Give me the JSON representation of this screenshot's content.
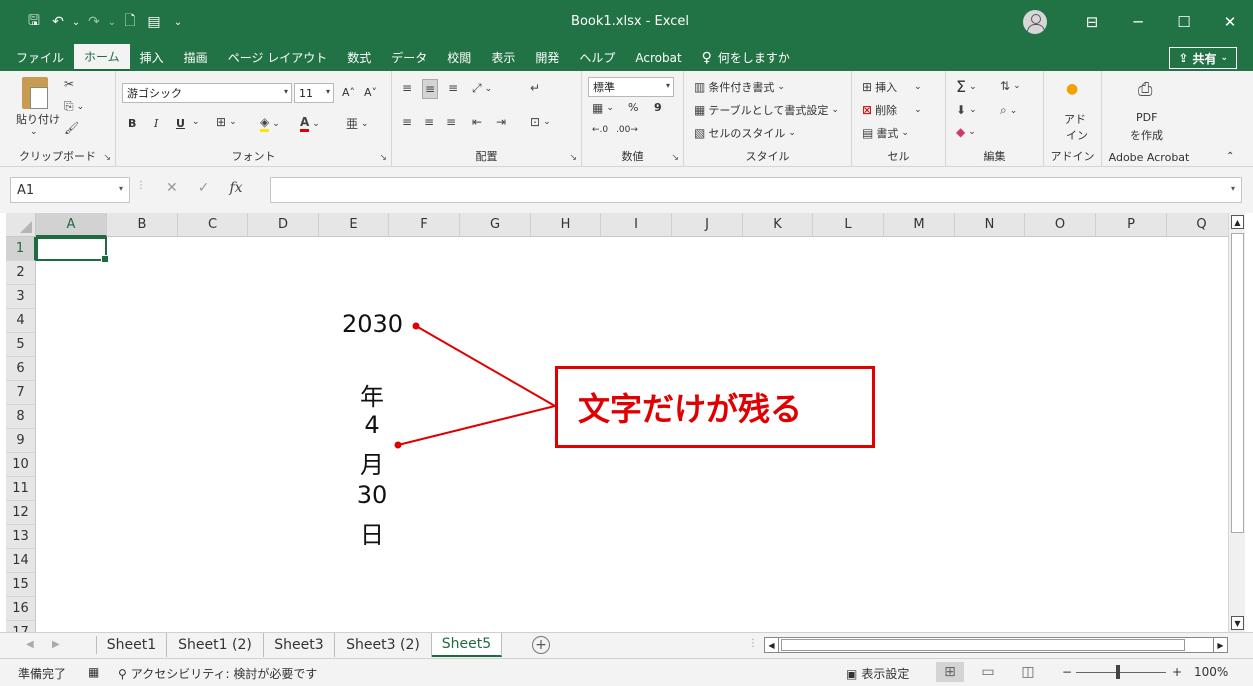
{
  "window": {
    "title": "Book1.xlsx  -  Excel",
    "share_label": "共有",
    "minimize": "─",
    "restore": "☐",
    "close": "✕",
    "ribbon_display": "⊟"
  },
  "qat": {
    "save": "🖫",
    "undo": "↶",
    "undo_caret": "⌄",
    "redo": "↷",
    "redo_caret": "⌄",
    "new": "🗋",
    "form": "▤",
    "customize": "⌄"
  },
  "tabs": [
    {
      "label": "ファイル"
    },
    {
      "label": "ホーム"
    },
    {
      "label": "挿入"
    },
    {
      "label": "描画"
    },
    {
      "label": "ページ レイアウト"
    },
    {
      "label": "数式"
    },
    {
      "label": "データ"
    },
    {
      "label": "校閲"
    },
    {
      "label": "表示"
    },
    {
      "label": "開発"
    },
    {
      "label": "ヘルプ"
    },
    {
      "label": "Acrobat"
    },
    {
      "label": "何をしますか"
    }
  ],
  "ribbon": {
    "clipboard": {
      "label": "クリップボード",
      "paste": "貼り付け"
    },
    "font": {
      "label": "フォント",
      "name": "游ゴシック",
      "size": "11",
      "bold": "B",
      "italic": "I",
      "underline": "U",
      "grow": "A˄",
      "shrink": "A˅"
    },
    "alignment": {
      "label": "配置"
    },
    "number": {
      "label": "数値",
      "format": "標準",
      "percent": "%",
      "comma": "9"
    },
    "styles": {
      "label": "スタイル",
      "conditional": "条件付き書式",
      "table": "テーブルとして書式設定",
      "cell_styles": "セルのスタイル"
    },
    "cells": {
      "label": "セル",
      "insert": "挿入",
      "delete": "削除",
      "format": "書式"
    },
    "editing": {
      "label": "編集",
      "sum": "Σ"
    },
    "addins": {
      "label": "アドイン",
      "button_line1": "アド",
      "button_line2": "イン"
    },
    "acrobat": {
      "label": "Adobe Acrobat",
      "button_line1": "PDF",
      "button_line2": "を作成"
    }
  },
  "formula_bar": {
    "name_box": "A1",
    "fx": "fx",
    "cancel": "✕",
    "enter": "✓",
    "formula": ""
  },
  "columns": [
    "A",
    "B",
    "C",
    "D",
    "E",
    "F",
    "G",
    "H",
    "I",
    "J",
    "K",
    "L",
    "M",
    "N",
    "O",
    "P",
    "Q"
  ],
  "rows": [
    "1",
    "2",
    "3",
    "4",
    "5",
    "6",
    "7",
    "8",
    "9",
    "10",
    "11",
    "12",
    "13",
    "14",
    "15",
    "16",
    "17"
  ],
  "cells": {
    "e4": "2030",
    "e7": "年",
    "e8": "4",
    "e9": "月",
    "e10": "30",
    "e11": "日"
  },
  "callout": {
    "text": "文字だけが残る",
    "color": "#e00000"
  },
  "sheets": [
    {
      "label": "Sheet1"
    },
    {
      "label": "Sheet1 (2)"
    },
    {
      "label": "Sheet3"
    },
    {
      "label": "Sheet3 (2)"
    },
    {
      "label": "Sheet5"
    }
  ],
  "active_sheet": "Sheet5",
  "status": {
    "ready": "準備完了",
    "accessibility": "アクセシビリティ: 検討が必要です",
    "display_settings": "表示設定",
    "zoom": "100%",
    "zoom_minus": "−",
    "zoom_plus": "+"
  },
  "colors": {
    "excel_green": "#217346",
    "accent": "#1e6b40"
  }
}
